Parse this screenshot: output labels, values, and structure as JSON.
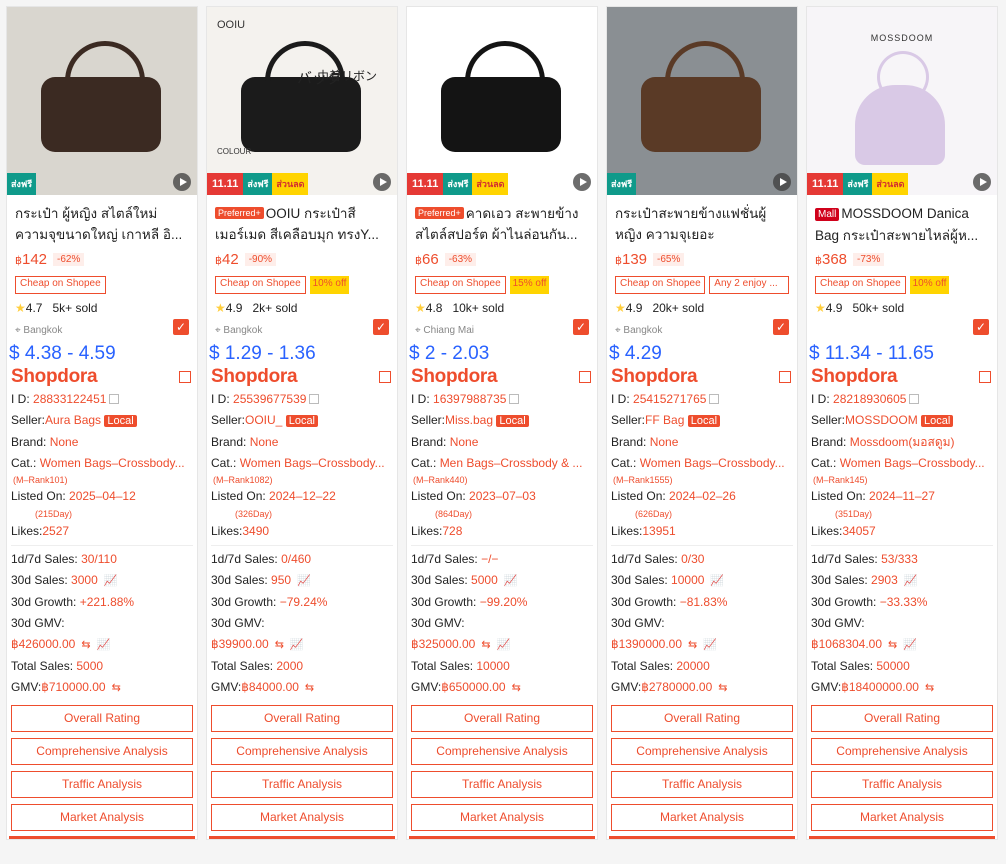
{
  "cards": [
    {
      "title": "กระเป๋า ผู้หญิง สไตล์ใหม่ ความจุขนาดใหญ่ เกาหลี อิ...",
      "tag": "",
      "price": "142",
      "pct": "-62%",
      "tag1": "Cheap on Shopee",
      "tag2": "",
      "rating": "4.7",
      "sold": "5k+ sold",
      "location": "Bangkok",
      "usd": "$ 4.38 - 4.59",
      "id": "28833122451",
      "seller": "Aura Bags",
      "brand": "None",
      "cat": "Women Bags–Crossbody...",
      "rank": "(M–Rank101)",
      "listed": "2025–04–12",
      "days": "(215Day)",
      "likes": "2527",
      "sales17": "30/110",
      "sales30": "3000",
      "growth": "+221.88%",
      "gmv30": "฿426000.00",
      "total": "5000",
      "gmv": "฿710000.00",
      "banner": "free",
      "photo_colors": [
        "#d9d6cf",
        "#3b2a22"
      ]
    },
    {
      "title": "OOIU กระเป๋าสีเมอร์เมด สีเคลือบมุก ทรงY...",
      "tag": "Preferred+",
      "price": "42",
      "pct": "-90%",
      "tag1": "Cheap on Shopee",
      "tag2": "10% off",
      "rating": "4.9",
      "sold": "2k+ sold",
      "location": "Bangkok",
      "usd": "$ 1.29 - 1.36",
      "id": "25539677539",
      "seller": "OOIU_",
      "brand": "None",
      "cat": "Women Bags–Crossbody...",
      "rank": "(M–Rank1082)",
      "listed": "2024–12–22",
      "days": "(326Day)",
      "likes": "3490",
      "sales17": "0/460",
      "sales30": "950",
      "growth": "−79.24%",
      "gmv30": "฿39900.00",
      "total": "2000",
      "gmv": "฿84000.00",
      "banner": "1111",
      "photo_colors": [
        "#f4f2ee",
        "#1b1b1b"
      ],
      "photo_texts": [
        "OOIU",
        "COLOUR",
        "バッグ",
        "巾着リボン"
      ]
    },
    {
      "title": "คาดเอว สะพายข้าง สไตล์สปอร์ต ผ้าไนล่อนกัน...",
      "tag": "Preferred+",
      "price": "66",
      "pct": "-63%",
      "tag1": "Cheap on Shopee",
      "tag2": "15% off",
      "rating": "4.8",
      "sold": "10k+ sold",
      "location": "Chiang Mai",
      "usd": "$ 2 - 2.03",
      "id": "16397988735",
      "seller": "Miss.bag",
      "brand": "None",
      "cat": "Men Bags–Crossbody & ...",
      "rank": "(M–Rank440)",
      "listed": "2023–07–03",
      "days": "(864Day)",
      "likes": "728",
      "sales17": "−/−",
      "sales30": "5000",
      "growth": "−99.20%",
      "gmv30": "฿325000.00",
      "total": "10000",
      "gmv": "฿650000.00",
      "banner": "1111",
      "photo_colors": [
        "#ffffff",
        "#141414"
      ]
    },
    {
      "title": "กระเป๋าสะพายข้างแฟชั่นผู้หญิง ความจุเยอะ",
      "tag": "",
      "price": "139",
      "pct": "-65%",
      "tag1": "Cheap on Shopee",
      "tag2": "",
      "tag_any": "Any 2 enjoy ...",
      "rating": "4.9",
      "sold": "20k+ sold",
      "location": "Bangkok",
      "usd": "$ 4.29",
      "id": "25415271765",
      "seller": "FF Bag",
      "brand": "None",
      "cat": "Women Bags–Crossbody...",
      "rank": "(M–Rank1555)",
      "listed": "2024–02–26",
      "days": "(626Day)",
      "likes": "13951",
      "sales17": "0/30",
      "sales30": "10000",
      "growth": "−81.83%",
      "gmv30": "฿1390000.00",
      "total": "20000",
      "gmv": "฿2780000.00",
      "banner": "free",
      "photo_colors": [
        "#8a8f93",
        "#5a3a26"
      ]
    },
    {
      "title": "MOSSDOOM Danica Bag กระเป๋าสะพายไหล่ผู้ห...",
      "tag": "Mall",
      "price": "368",
      "pct": "-73%",
      "tag1": "Cheap on Shopee",
      "tag2": "10% off",
      "rating": "4.9",
      "sold": "50k+ sold",
      "location": "",
      "usd": "$ 11.34 - 11.65",
      "id": "28218930605",
      "seller": "MOSSDOOM",
      "brand": "Mossdoom(มอสดูม)",
      "cat": "Women Bags–Crossbody...",
      "rank": "(M–Rank145)",
      "listed": "2024–11–27",
      "days": "(351Day)",
      "likes": "34057",
      "sales17": "53/333",
      "sales30": "2903",
      "growth": "−33.33%",
      "gmv30": "฿1068304.00",
      "total": "50000",
      "gmv": "฿18400000.00",
      "banner": "1111",
      "photo_colors": [
        "#f7f5f8",
        "#d9c9e6"
      ],
      "photo_texts": [
        "MOSSDOOM"
      ]
    }
  ],
  "labels": {
    "id": "I D:",
    "seller": "Seller:",
    "local": "Local",
    "brand": "Brand:",
    "cat": "Cat.:",
    "listed": "Listed On:",
    "likes": "Likes:",
    "sales17": "1d/7d Sales:",
    "sales30": "30d Sales:",
    "growth": "30d Growth:",
    "gmv30": "30d GMV:",
    "total": "Total Sales:",
    "gmv": "GMV:",
    "btn_overall": "Overall Rating",
    "btn_comp": "Comprehensive Analysis",
    "btn_traffic": "Traffic Analysis",
    "btn_market": "Market Analysis",
    "logo": "Shopdora",
    "banner_1111": "11.11",
    "banner_free": "ส่งฟรี",
    "banner_disc": "ส่วนลด",
    "currency": "฿"
  },
  "colors": {
    "accent": "#ee4d2d",
    "usd": "#2962ff",
    "star": "#ffce3d"
  },
  "icons": [
    "play-icon",
    "check-icon",
    "copy-icon",
    "external-link-icon",
    "chart-icon",
    "swap-icon",
    "location-icon",
    "star-icon"
  ]
}
